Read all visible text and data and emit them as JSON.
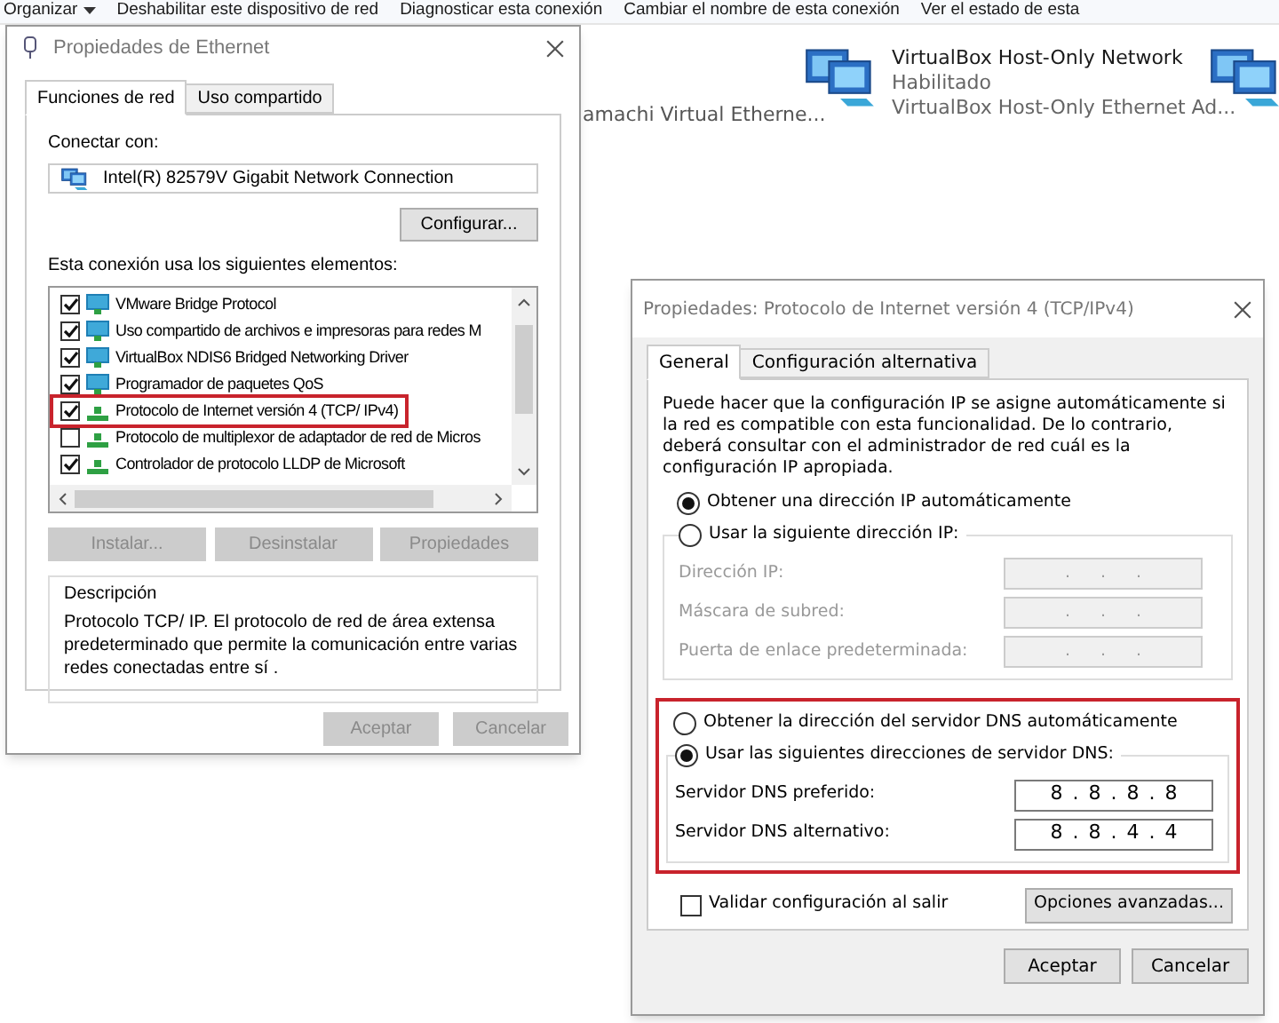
{
  "explorer": {
    "toolbar": [
      {
        "label": "Organizar",
        "kind": "menu"
      },
      {
        "label": "Deshabilitar este dispositivo de red",
        "kind": "command"
      },
      {
        "label": "Diagnosticar esta conexión",
        "kind": "command"
      },
      {
        "label": "Cambiar el nombre de esta conexión",
        "kind": "command"
      },
      {
        "label": "Ver el estado de esta",
        "kind": "command"
      }
    ],
    "partial_connection": "amachi Virtual Etherne...",
    "connections": [
      {
        "name": "VirtualBox Host-Only Network",
        "status": "Habilitado",
        "device": "VirtualBox Host-Only Ethernet Ad..."
      }
    ]
  },
  "ethernet_dialog": {
    "title": "Propiedades de Ethernet",
    "tabs": [
      {
        "label": "Funciones de red",
        "selected": true
      },
      {
        "label": "Uso compartido",
        "selected": false
      }
    ],
    "connect_with_label": "Conectar con:",
    "adapter": "Intel(R) 82579V Gigabit Network Connection",
    "configure_button": "Configurar...",
    "items_label": "Esta conexión usa los siguientes elementos:",
    "items": [
      {
        "label": "VMware Bridge Protocol",
        "checked": true,
        "kind": "client",
        "highlighted": false
      },
      {
        "label": "Uso compartido de archivos e impresoras para redes M",
        "checked": true,
        "kind": "client",
        "highlighted": false
      },
      {
        "label": "VirtualBox NDIS6 Bridged Networking Driver",
        "checked": true,
        "kind": "client",
        "highlighted": false
      },
      {
        "label": "Programador de paquetes QoS",
        "checked": true,
        "kind": "client",
        "highlighted": false
      },
      {
        "label": "Protocolo de Internet versión 4 (TCP/ IPv4)",
        "checked": true,
        "kind": "protocol",
        "highlighted": true
      },
      {
        "label": "Protocolo de multiplexor de adaptador de red de Micros",
        "checked": false,
        "kind": "protocol",
        "highlighted": false
      },
      {
        "label": "Controlador de protocolo LLDP de Microsoft",
        "checked": true,
        "kind": "protocol",
        "highlighted": false
      }
    ],
    "item_buttons": [
      {
        "label": "Instalar...",
        "disabled": true
      },
      {
        "label": "Desinstalar",
        "disabled": true
      },
      {
        "label": "Propiedades",
        "disabled": true
      }
    ],
    "description_title": "Descripción",
    "description": "Protocolo TCP/ IP. El protocolo de red de área extensa predeterminado que permite la comunicación entre varias redes conectadas entre sí .",
    "buttons": [
      {
        "label": "Aceptar",
        "disabled": true
      },
      {
        "label": "Cancelar",
        "disabled": true
      }
    ]
  },
  "ipv4_dialog": {
    "title": "Propiedades: Protocolo de Internet versión 4 (TCP/IPv4)",
    "tabs": [
      {
        "label": "General",
        "selected": true
      },
      {
        "label": "Configuración alternativa",
        "selected": false
      }
    ],
    "intro": "Puede hacer que la configuración IP se asigne automáticamente si la red es compatible con esta funcionalidad. De lo contrario, deberá consultar con el administrador de red cuál es la configuración IP apropiada.",
    "ip_options": [
      {
        "label": "Obtener una dirección IP automáticamente",
        "selected": true
      },
      {
        "label": "Usar la siguiente dirección IP:",
        "selected": false
      }
    ],
    "ip_fields": [
      {
        "label": "Dirección IP:",
        "value": ". . .",
        "disabled": true
      },
      {
        "label": "Máscara de subred:",
        "value": ". . .",
        "disabled": true
      },
      {
        "label": "Puerta de enlace predeterminada:",
        "value": ". . .",
        "disabled": true
      }
    ],
    "dns_highlighted": true,
    "dns_options": [
      {
        "label": "Obtener la dirección del servidor DNS automáticamente",
        "selected": false
      },
      {
        "label": "Usar las siguientes direcciones de servidor DNS:",
        "selected": true
      }
    ],
    "dns_fields": [
      {
        "label": "Servidor DNS preferido:",
        "value": "8 . 8 . 8 . 8",
        "disabled": false
      },
      {
        "label": "Servidor DNS alternativo:",
        "value": "8 . 8 . 4 . 4",
        "disabled": false
      }
    ],
    "validate": {
      "label": "Validar configuración al salir",
      "checked": false
    },
    "advanced_button": "Opciones avanzadas...",
    "buttons": [
      {
        "label": "Aceptar",
        "disabled": false
      },
      {
        "label": "Cancelar",
        "disabled": false
      }
    ]
  }
}
